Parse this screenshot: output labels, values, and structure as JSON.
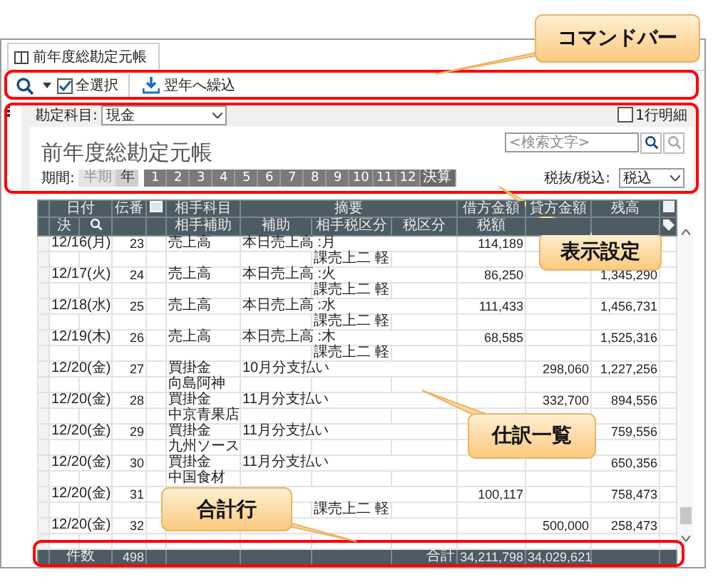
{
  "window": {
    "tab": "前年度総勘定元帳"
  },
  "toolbar": {
    "select_all": {
      "label": "全選択",
      "checked": true
    },
    "carry_forward": "翌年へ繰込"
  },
  "settings": {
    "account_label": "勘定科目:",
    "account": "現金",
    "detail": {
      "label": "1行明細",
      "checked": false
    },
    "title": "前年度総勘定元帳",
    "search": {
      "placeholder": "<検索文字>"
    },
    "period_label": "期間:",
    "period_modes": [
      {
        "label": "半期",
        "selected": false
      },
      {
        "label": "年",
        "selected": true
      }
    ],
    "months": [
      "1",
      "2",
      "3",
      "4",
      "5",
      "6",
      "7",
      "8",
      "9",
      "10",
      "11",
      "12",
      "決算"
    ],
    "tax_label": "税抜/税込:",
    "tax_mode": "税込"
  },
  "table": {
    "header_top": [
      "日付",
      "伝番",
      "相手科目",
      "摘要",
      "借方金額",
      "貸方金額",
      "残高"
    ],
    "header_bottom": [
      "決",
      "相手補助",
      "補助",
      "相手税区分",
      "税区分",
      "税額"
    ],
    "rows": [
      {
        "date": "12/16(月)",
        "no": "23",
        "account": "売上高",
        "memo": "本日売上高 :月",
        "debit": "114,189",
        "tax_class": "課売上二 軽"
      },
      {
        "date": "12/17(火)",
        "no": "24",
        "account": "売上高",
        "memo": "本日売上高 :火",
        "debit": "86,250",
        "balance": "1,345,290",
        "tax_class": "課売上二 軽"
      },
      {
        "date": "12/18(水)",
        "no": "25",
        "account": "売上高",
        "memo": "本日売上高 :水",
        "debit": "111,433",
        "balance": "1,456,731",
        "tax_class": "課売上二 軽"
      },
      {
        "date": "12/19(木)",
        "no": "26",
        "account": "売上高",
        "memo": "本日売上高 :木",
        "debit": "68,585",
        "balance": "1,525,316",
        "tax_class": "課売上二 軽"
      },
      {
        "date": "12/20(金)",
        "no": "27",
        "account": "買掛金",
        "memo": "10月分支払い",
        "credit": "298,060",
        "balance": "1,227,256",
        "sub_account": "向島阿神"
      },
      {
        "date": "12/20(金)",
        "no": "28",
        "account": "買掛金",
        "memo": "11月分支払い",
        "credit": "332,700",
        "balance": "894,556",
        "sub_account": "中京青果店"
      },
      {
        "date": "12/20(金)",
        "no": "29",
        "account": "買掛金",
        "memo": "11月分支払い",
        "balance": "759,556",
        "sub_account": "九州ソース"
      },
      {
        "date": "12/20(金)",
        "no": "30",
        "account": "買掛金",
        "memo": "11月分支払い",
        "balance": "650,356",
        "sub_account": "中国食材"
      },
      {
        "date": "12/20(金)",
        "no": "31",
        "debit": "100,117",
        "balance": "758,473",
        "tax_class": "課売上二 軽"
      },
      {
        "date": "12/20(金)",
        "no": "32",
        "credit": "500,000",
        "balance": "258,473"
      }
    ],
    "footer": {
      "count_label": "件数",
      "count": "498",
      "total_label": "合計",
      "debit": "34,211,798",
      "credit": "34,029,621"
    }
  },
  "annotations": [
    {
      "label": "コマンドバー"
    },
    {
      "label": "表示設定"
    },
    {
      "label": "仕訳一覧"
    },
    {
      "label": "合計行"
    }
  ]
}
